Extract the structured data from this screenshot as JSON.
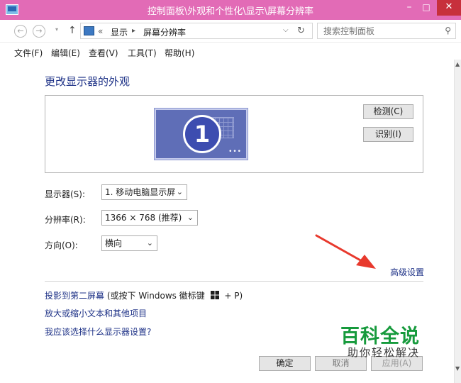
{
  "window": {
    "title": "控制面板\\外观和个性化\\显示\\屏幕分辨率",
    "minimize": "–",
    "maximize": "□",
    "close": "✕"
  },
  "nav": {
    "back": "←",
    "forward": "→",
    "recent": "▾",
    "up": "↑",
    "breadcrumb_sep": "«",
    "crumb1": "显示",
    "crumb_arrow": "▸",
    "crumb2": "屏幕分辨率",
    "dropdown": "⌵",
    "refresh": "↻"
  },
  "search": {
    "placeholder": "搜索控制面板",
    "icon": "⚲"
  },
  "menu": [
    "文件(F)",
    "编辑(E)",
    "查看(V)",
    "工具(T)",
    "帮助(H)"
  ],
  "page": {
    "title": "更改显示器的外观",
    "monitor_number": "1",
    "monitor_dots": "•••",
    "detect_button": "检测(C)",
    "identify_button": "识别(I)"
  },
  "form": {
    "display_label": "显示器(S):",
    "display_value": "1. 移动电脑显示屏",
    "resolution_label": "分辨率(R):",
    "resolution_value": "1366 × 768 (推荐)",
    "orientation_label": "方向(O):",
    "orientation_value": "横向",
    "chevron": "⌄",
    "advanced_link": "高级设置"
  },
  "links": {
    "project": "投影到第二屏幕",
    "project_hint_pre": "(或按下 Windows 徽标键",
    "project_hint_post": "+ P)",
    "enlarge": "放大或缩小文本和其他项目",
    "which": "我应该选择什么显示器设置?"
  },
  "buttons": {
    "ok": "确定",
    "cancel": "取消",
    "apply": "应用(A)"
  },
  "watermark": {
    "line1": "百科全说",
    "line2": "助你轻松解决"
  },
  "colors": {
    "titlebar": "#e26bb6",
    "link": "#1e3287",
    "monitor": "#5f6eb7",
    "arrow": "#e8392d",
    "watermark_green": "#169a3c"
  }
}
